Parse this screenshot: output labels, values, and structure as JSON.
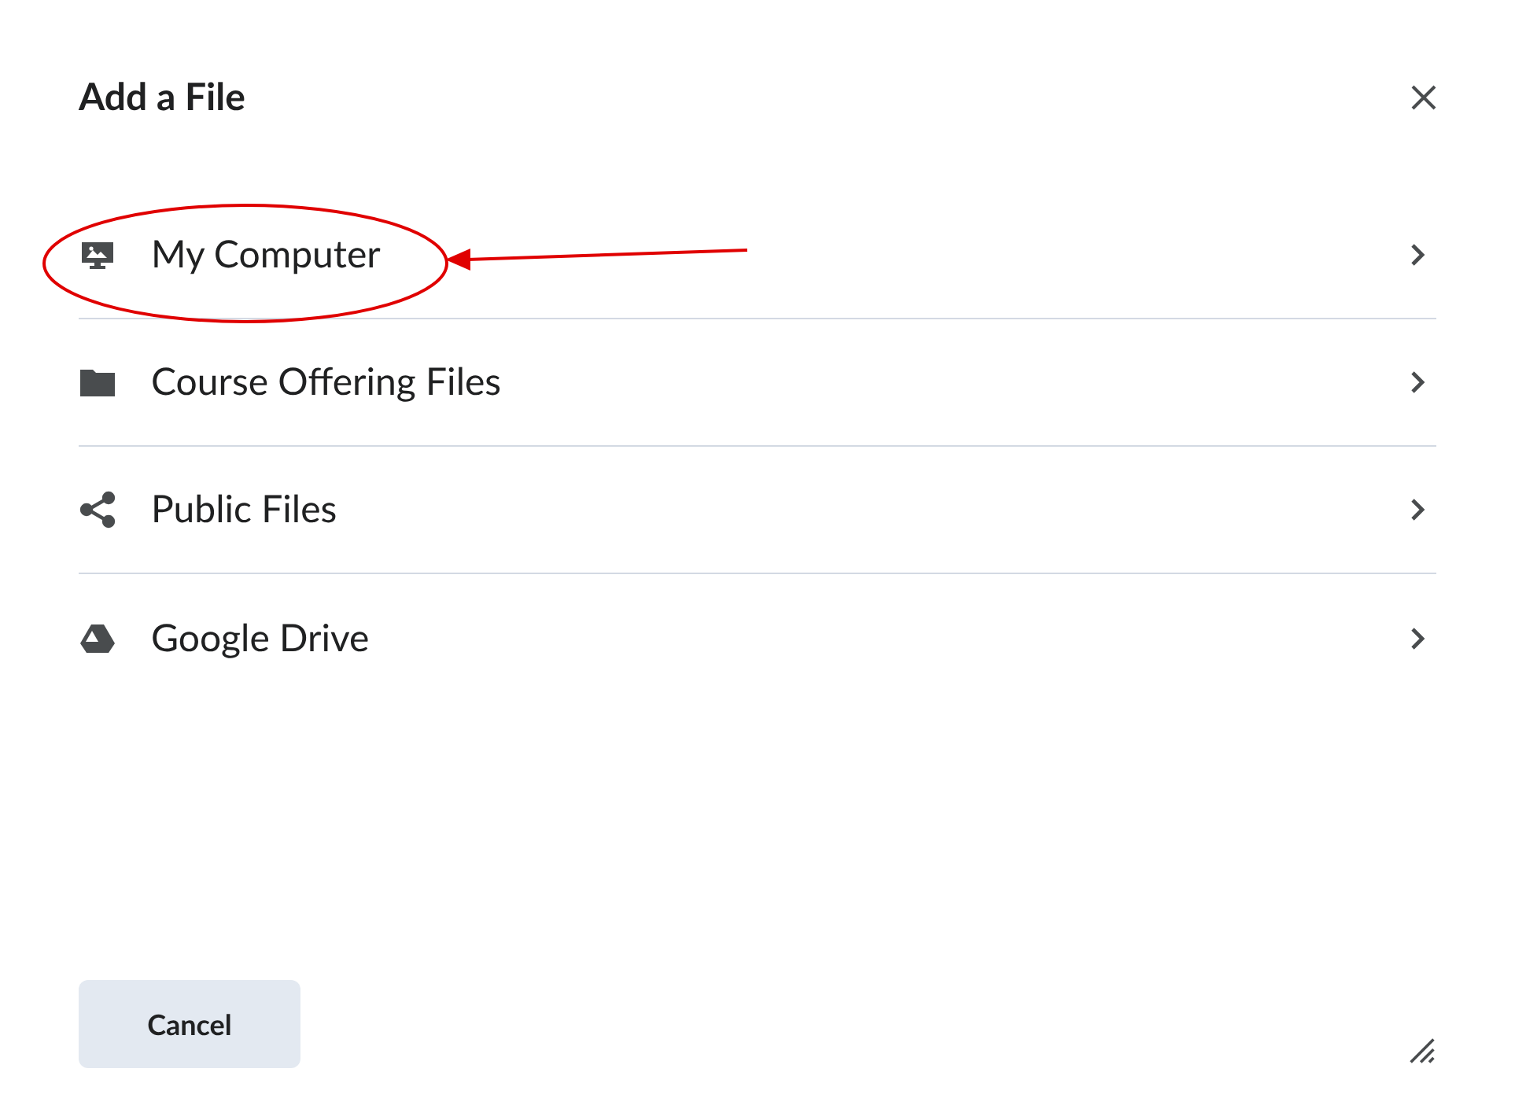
{
  "dialog": {
    "title": "Add a File"
  },
  "sources": [
    {
      "kind": "computer",
      "label": "My Computer"
    },
    {
      "kind": "folder",
      "label": "Course Offering Files"
    },
    {
      "kind": "share",
      "label": "Public Files"
    },
    {
      "kind": "drive",
      "label": "Google Drive"
    }
  ],
  "footer": {
    "cancel": "Cancel"
  }
}
